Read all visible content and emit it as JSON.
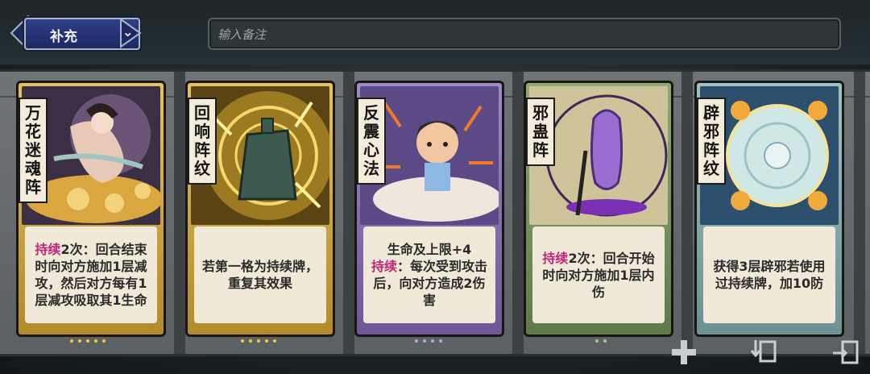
{
  "filter": {
    "selected": "补充",
    "chevron": "chevron-down-icon"
  },
  "notes": {
    "placeholder": "输入备注",
    "value": ""
  },
  "cards": [
    {
      "name": [
        "万",
        "花",
        "迷",
        "魂",
        "阵"
      ],
      "frame": "gold",
      "desc_keyword": "持续",
      "desc_rest": "2次：回合结束时向对方施加1层减攻，然后对方每有1层减攻吸取其1生命",
      "desc_pre": ""
    },
    {
      "name": [
        "回",
        "响",
        "阵",
        "纹"
      ],
      "frame": "gold",
      "desc_keyword": "",
      "desc_rest": "若第一格为持续牌，重复其效果",
      "desc_pre": ""
    },
    {
      "name": [
        "反",
        "震",
        "心",
        "法"
      ],
      "frame": "purple",
      "desc_pre": "生命及上限+4",
      "desc_keyword": "持续",
      "desc_rest": "：每次受到攻击后，向对方造成2伤害"
    },
    {
      "name": [
        "邪",
        "蛊",
        "阵"
      ],
      "frame": "green",
      "desc_keyword": "持续",
      "desc_rest": "2次：回合开始时向对方施加1层内伤",
      "desc_pre": ""
    },
    {
      "name": [
        "辟",
        "邪",
        "阵",
        "纹"
      ],
      "frame": "teal",
      "desc_keyword": "",
      "desc_rest": "获得3层辟邪若使用过持续牌，加10防",
      "desc_pre": ""
    }
  ],
  "colors": {
    "keyword": "#c0237a",
    "gold": "#d8b33c",
    "purple": "#8a6fb0",
    "green": "#6f8f5a",
    "teal": "#7fa6a8"
  },
  "buttons": {
    "add": "plus-icon",
    "import": "import-deck-icon",
    "export": "export-deck-icon"
  }
}
